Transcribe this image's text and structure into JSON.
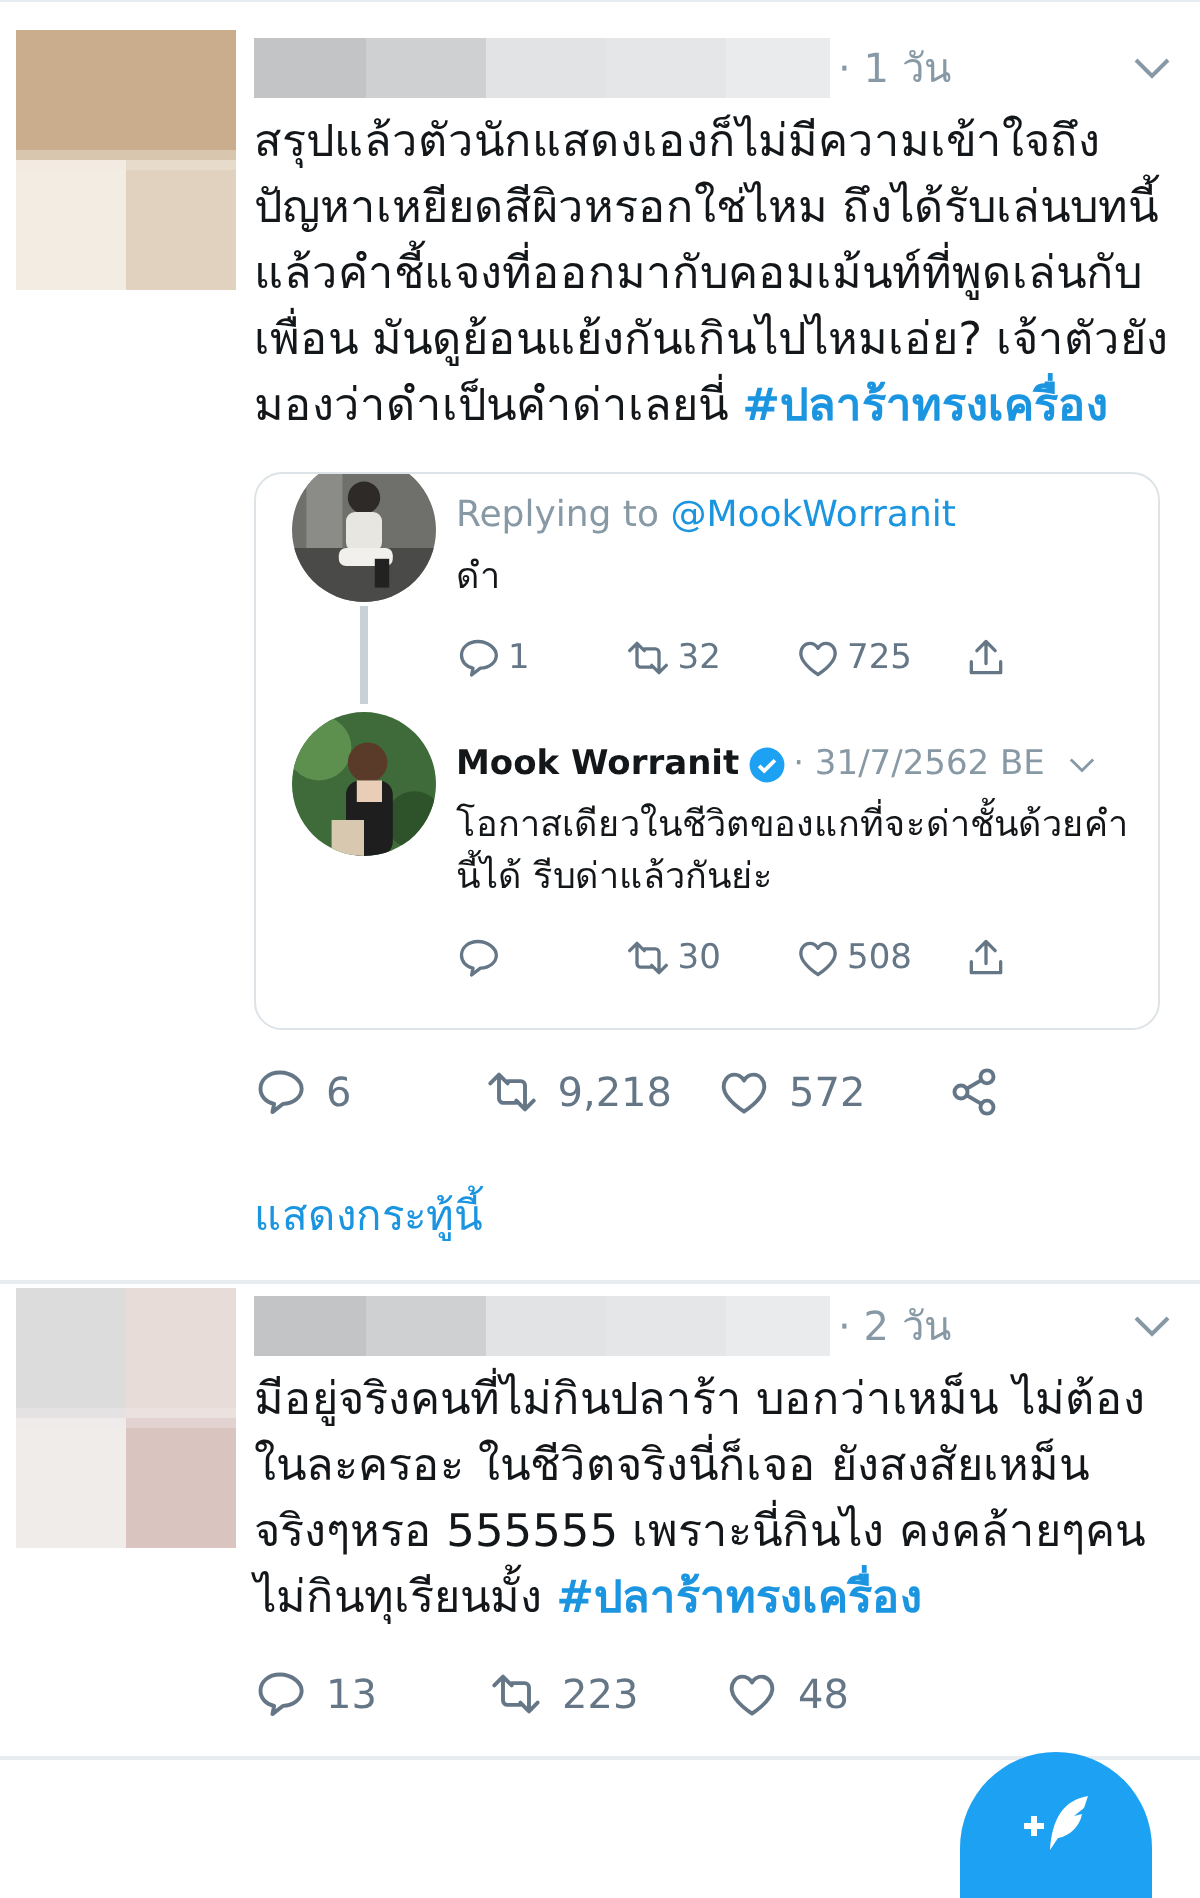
{
  "tweets": [
    {
      "avatar": {
        "kind": "picture"
      },
      "time": "· 1 วัน",
      "text": "สรุปแล้วตัวนักแสดงเองก็ไม่มีความเข้าใจถึงปัญหาเหยียดสีผิวหรอกใช่ไหม ถึงได้รับเล่นบทนี้ แล้วคำชี้แจงที่ออกมากับคอมเม้นท์ที่พูดเล่นกับเพื่อน มันดูย้อนแย้งกันเกินไปไหมเอ่ย? เจ้าตัวยังมองว่าดำเป็นคำด่าเลยนี่ ",
      "hashtag": "#ปลาร้าทรงเครื่อง",
      "quoted": [
        {
          "replying_label": "Replying to ",
          "replying_handle": "@MookWorranit",
          "text": "ดำ",
          "actions": [
            {
              "kind": "reply",
              "count": "1"
            },
            {
              "kind": "retweet",
              "count": "32"
            },
            {
              "kind": "like",
              "count": "725"
            },
            {
              "kind": "share"
            }
          ]
        },
        {
          "name": "Mook Worranit",
          "verified": true,
          "time": "· 31/7/2562 BE",
          "text": "โอกาสเดียวในชีวิตของแกที่จะด่าชั้นด้วยคำนี้ได้ รีบด่าแล้วกันย่ะ",
          "actions": [
            {
              "kind": "reply"
            },
            {
              "kind": "retweet",
              "count": "30"
            },
            {
              "kind": "like",
              "count": "508"
            },
            {
              "kind": "share"
            }
          ]
        }
      ],
      "actions": [
        {
          "kind": "reply",
          "count": "6"
        },
        {
          "kind": "retweet",
          "count": "9,218"
        },
        {
          "kind": "like",
          "count": "572"
        },
        {
          "kind": "share_android"
        }
      ],
      "show_thread": "แสดงกระทู้นี้"
    },
    {
      "avatar": {
        "kind": "picture"
      },
      "time": "· 2 วัน",
      "text": "มีอยู่จริงคนที่ไม่กินปลาร้า บอกว่าเหม็น ไม่ต้องในละครอะ ในชีวิตจริงนี่ก็เจอ ยังสงสัยเหม็นจริงๆหรอ 555555 เพราะนี่กินไง คงคล้ายๆคนไม่กินทุเรียนมั้ง ",
      "hashtag": "#ปลาร้าทรงเครื่อง",
      "actions": [
        {
          "kind": "reply",
          "count": "13"
        },
        {
          "kind": "retweet",
          "count": "223"
        },
        {
          "kind": "like",
          "count": "48"
        }
      ]
    }
  ],
  "compose_button": {
    "kind": "compose"
  }
}
